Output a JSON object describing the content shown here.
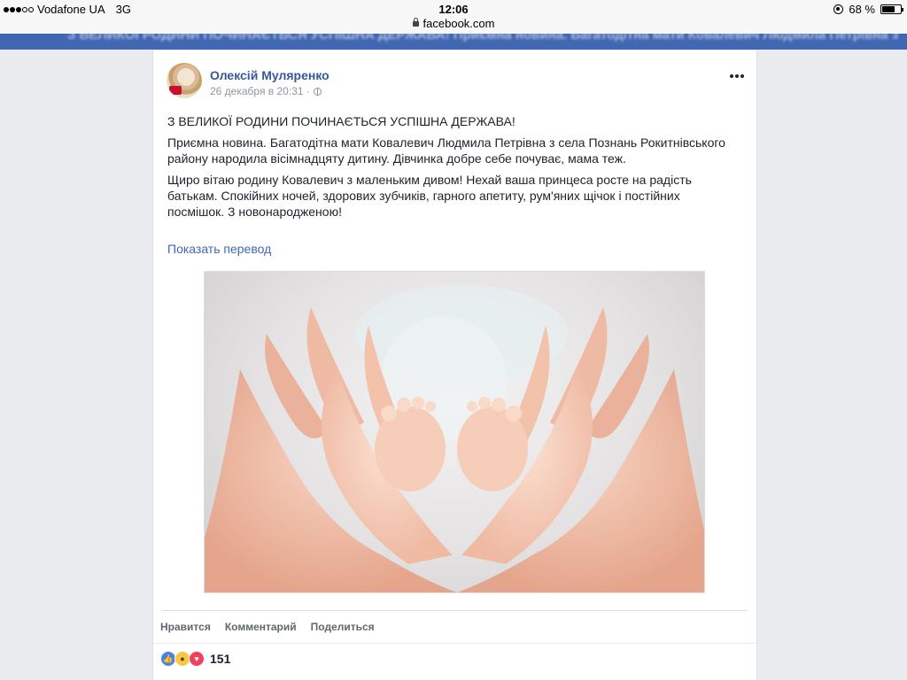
{
  "status_bar": {
    "carrier": "Vodafone UA",
    "network": "3G",
    "time": "12:06",
    "battery": "68 %",
    "battery_level": 0.68
  },
  "url_bar": {
    "domain": "facebook.com"
  },
  "header": {
    "blurred_text": "З ВЕЛИКОЇ РОДИНИ ПОЧИНАЄТЬСЯ УСПІШНА ДЕРЖАВА! Приємна новина. Багатодітна мати Ковалевич Людмила Петрівна з села Познань"
  },
  "post": {
    "author": "Олексій Муляренко",
    "timestamp": "26 декабря в 20:31 ·",
    "paragraphs": [
      "З ВЕЛИКОЇ РОДИНИ ПОЧИНАЄТЬСЯ УСПІШНА ДЕРЖАВА!",
      "Приємна новина. Багатодітна мати Ковалевич Людмила Петрівна з села Познань Рокитнівського району народила вісімнадцяту дитину. Дівчинка добре себе почуває, мама теж.",
      "Щиро вітаю родину Ковалевич з маленьким дивом! Нехай ваша принцеса росте на радість батькам. Спокійних ночей, здорових зубчиків, гарного апетиту, рум'яних щічок і постійних посмішок. З новонародженою!"
    ],
    "translate_link": "Показать перевод",
    "photo_icon": "baby-feet-in-hands-photo"
  },
  "actions": {
    "like": "Нравится",
    "comment": "Комментарий",
    "share": "Поделиться"
  },
  "reactions": {
    "icons": [
      "like-reaction-icon",
      "wow-reaction-icon",
      "love-reaction-icon"
    ],
    "count": "151"
  },
  "colors": {
    "brand_blue": "#4267b2",
    "link_blue": "#365899",
    "background": "#e9ebee"
  }
}
